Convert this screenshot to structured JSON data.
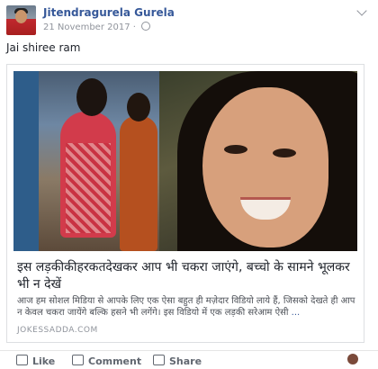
{
  "post": {
    "author": "Jitendragurela Gurela",
    "date": "21 November 2017",
    "meta_sep": "·",
    "text": "Jai shiree ram"
  },
  "link": {
    "headline": "इस लड़कीकीहरकतदेखकर आप भी चकरा जाएंगे, बच्चो के सामने भूलकर भी न देखें",
    "description": "आज हम सोशल मिडिया से आपके लिए एक ऐसा बहुत ही मज़ेदार विडियो लाये हैं, जिसको देखते ही आप न केवल चकरा जायेंगे बल्कि हसने भी लगेंगे। इस विडियो में एक लड़की सरेआम ऐसी",
    "more": "...",
    "domain": "JOKESSADDA.COM"
  },
  "actions": {
    "like": "Like",
    "comment": "Comment",
    "share": "Share"
  },
  "icons": [
    "avatar",
    "globe-icon",
    "chevron-down-icon",
    "like-icon",
    "comment-icon",
    "share-icon"
  ],
  "colors": {
    "author_link": "#365899",
    "meta": "#90949c"
  }
}
